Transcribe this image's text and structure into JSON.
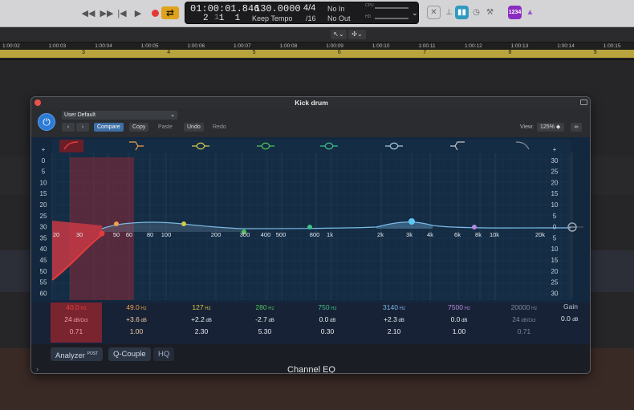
{
  "transport": {
    "position_time": "01:00:01.846",
    "position_bars": "2  1  1",
    "position_ticks": "1",
    "tempo": "130.0000",
    "tempo_mode": "Keep Tempo",
    "signature_top": "4/4",
    "signature_div": "/16",
    "in": "No In",
    "out": "No Out",
    "cpu_label": "CPU",
    "hd_label": "HD",
    "counter_badge": "1234"
  },
  "ruler": {
    "times": [
      "1:00:02",
      "1:00:03",
      "1:00:04",
      "1:00:05",
      "1:00:06",
      "1:00:07",
      "1:00:08",
      "1:00:09",
      "1:00:10",
      "1:00:11",
      "1:00:12",
      "1:00:13",
      "1:00:14",
      "1:00:15"
    ],
    "bars": [
      "3",
      "4",
      "5",
      "6",
      "7",
      "8",
      "9"
    ]
  },
  "plugin": {
    "title": "Kick drum",
    "preset": "User Default",
    "compare": "Compare",
    "copy": "Copy",
    "paste": "Paste",
    "undo": "Undo",
    "redo": "Redo",
    "view_label": "View:",
    "view_value": "125%",
    "left_scale": [
      "+",
      "0",
      "5",
      "10",
      "15",
      "20",
      "25",
      "30",
      "35",
      "40",
      "45",
      "50",
      "55",
      "60"
    ],
    "right_scale": [
      "+",
      "30",
      "25",
      "20",
      "15",
      "10",
      "5",
      "0",
      "5",
      "10",
      "15",
      "20",
      "25",
      "30"
    ],
    "freq_labels": [
      "20",
      "30",
      "50",
      "60",
      "80",
      "100",
      "200",
      "300",
      "400",
      "500",
      "800",
      "1k",
      "2k",
      "3k",
      "4k",
      "6k",
      "8k",
      "10k",
      "20k"
    ],
    "bands": [
      {
        "freq": "40.0",
        "freq_unit": "Hz",
        "gain": "24",
        "gain_unit": "dB/Oct",
        "q": "0.71",
        "color": "#e4403c"
      },
      {
        "freq": "49.0",
        "freq_unit": "Hz",
        "gain": "+3.6",
        "gain_unit": "dB",
        "q": "1.00",
        "color": "#f0a04a"
      },
      {
        "freq": "127",
        "freq_unit": "Hz",
        "gain": "+2.2",
        "gain_unit": "dB",
        "q": "2.30",
        "color": "#d4c94a"
      },
      {
        "freq": "280",
        "freq_unit": "Hz",
        "gain": "-2.7",
        "gain_unit": "dB",
        "q": "5.30",
        "color": "#4ec25a"
      },
      {
        "freq": "750",
        "freq_unit": "Hz",
        "gain": "0.0",
        "gain_unit": "dB",
        "q": "0.30",
        "color": "#3ec08a"
      },
      {
        "freq": "3140",
        "freq_unit": "Hz",
        "gain": "+2.3",
        "gain_unit": "dB",
        "q": "2.10",
        "color": "#7ab6e8"
      },
      {
        "freq": "7500",
        "freq_unit": "Hz",
        "gain": "0.0",
        "gain_unit": "dB",
        "q": "1.00",
        "color": "#b48ae0"
      },
      {
        "freq": "20000",
        "freq_unit": "Hz",
        "gain": "24",
        "gain_unit": "dB/Oct",
        "q": "0.71",
        "color": "#7f8899"
      }
    ],
    "gain_label": "Gain",
    "gain_value": "0.0",
    "gain_unit": "dB",
    "analyzer": "Analyzer",
    "analyzer_mode": "POST",
    "qcouple": "Q-Couple",
    "hq": "HQ",
    "footer": "Channel EQ"
  }
}
